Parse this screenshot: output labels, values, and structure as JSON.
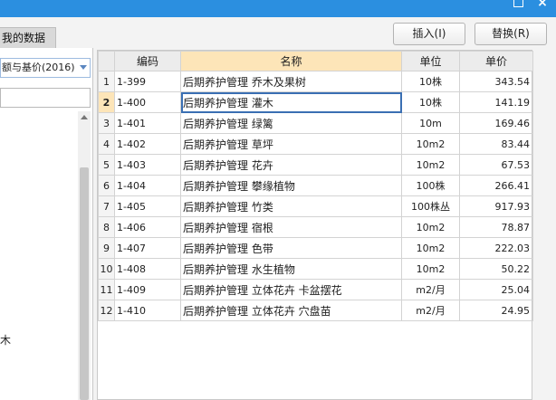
{
  "left": {
    "tab_label": "我的数据",
    "select_value": "额与基价(2016)",
    "tree_item": "木"
  },
  "toolbar": {
    "insert_label": "插入(I)",
    "replace_label": "替换(R)"
  },
  "table": {
    "headers": [
      "",
      "编码",
      "名称",
      "单位",
      "单价"
    ],
    "rows": [
      {
        "idx": "1",
        "code": "1-399",
        "name": "后期养护管理 乔木及果树",
        "unit": "10株",
        "price": "343.54"
      },
      {
        "idx": "2",
        "code": "1-400",
        "name": "后期养护管理 灌木",
        "unit": "10株",
        "price": "141.19"
      },
      {
        "idx": "3",
        "code": "1-401",
        "name": "后期养护管理 绿篱",
        "unit": "10m",
        "price": "169.46"
      },
      {
        "idx": "4",
        "code": "1-402",
        "name": "后期养护管理 草坪",
        "unit": "10m2",
        "price": "83.44"
      },
      {
        "idx": "5",
        "code": "1-403",
        "name": "后期养护管理 花卉",
        "unit": "10m2",
        "price": "67.53"
      },
      {
        "idx": "6",
        "code": "1-404",
        "name": "后期养护管理 攀缘植物",
        "unit": "100株",
        "price": "266.41"
      },
      {
        "idx": "7",
        "code": "1-405",
        "name": "后期养护管理 竹类",
        "unit": "100株丛",
        "price": "917.93"
      },
      {
        "idx": "8",
        "code": "1-406",
        "name": "后期养护管理 宿根",
        "unit": "10m2",
        "price": "78.87"
      },
      {
        "idx": "9",
        "code": "1-407",
        "name": "后期养护管理 色带",
        "unit": "10m2",
        "price": "222.03"
      },
      {
        "idx": "10",
        "code": "1-408",
        "name": "后期养护管理 水生植物",
        "unit": "10m2",
        "price": "50.22"
      },
      {
        "idx": "11",
        "code": "1-409",
        "name": "后期养护管理 立体花卉 卡盆摆花",
        "unit": "m2/月",
        "price": "25.04"
      },
      {
        "idx": "12",
        "code": "1-410",
        "name": "后期养护管理 立体花卉 穴盘苗",
        "unit": "m2/月",
        "price": "24.95"
      }
    ]
  }
}
